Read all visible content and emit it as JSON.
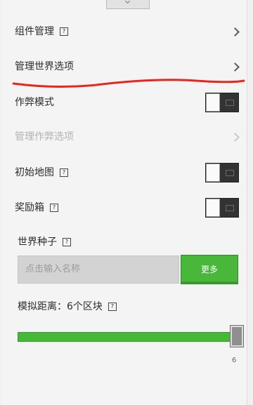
{
  "settings": {
    "items": [
      {
        "label": "组件管理",
        "help": true,
        "type": "link",
        "enabled": true
      },
      {
        "label": "管理世界选项",
        "help": false,
        "type": "link",
        "enabled": true
      },
      {
        "label": "作弊模式",
        "help": false,
        "type": "toggle",
        "on": false
      },
      {
        "label": "管理作弊选项",
        "help": false,
        "type": "link",
        "enabled": false
      },
      {
        "label": "初始地图",
        "help": true,
        "type": "toggle",
        "on": false
      },
      {
        "label": "奖励箱",
        "help": true,
        "type": "toggle",
        "on": false
      }
    ]
  },
  "seed": {
    "label": "世界种子",
    "placeholder": "点击输入名称",
    "more_label": "更多"
  },
  "distance": {
    "label": "模拟距离：6个区块",
    "value": 6,
    "value_text": "6",
    "fraction": 1.0
  },
  "colors": {
    "accent_green": "#49b73a",
    "annotation_red": "#e8261e",
    "toggle_off": "#333333"
  },
  "icons": {
    "help": "help-icon",
    "chevron": "chevron-right-icon",
    "handle": "chevron-down-icon"
  }
}
